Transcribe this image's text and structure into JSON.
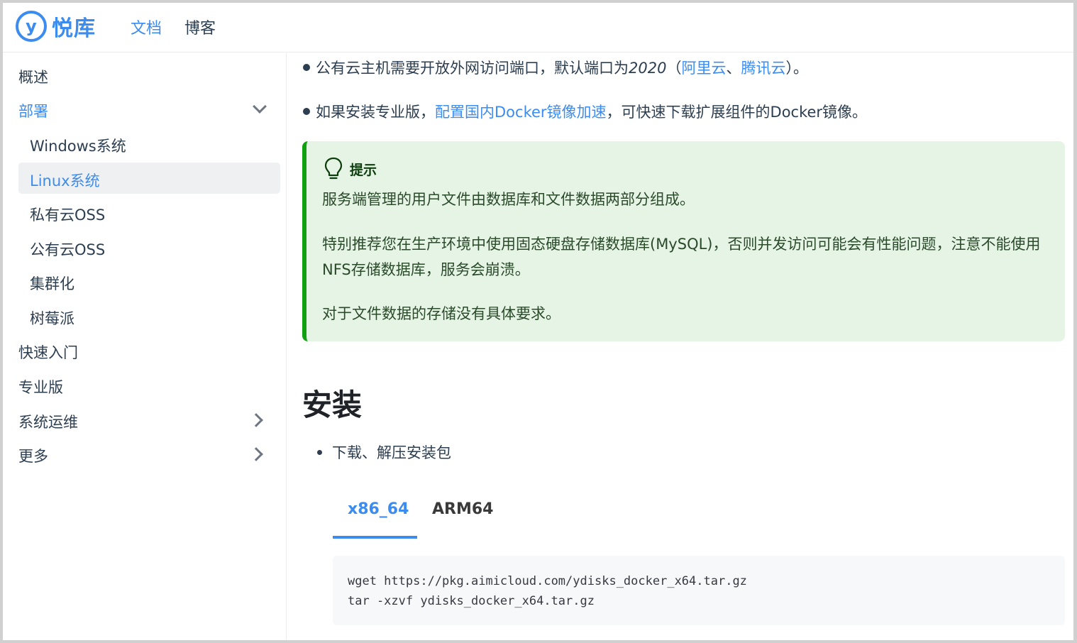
{
  "header": {
    "logo_glyph": "y",
    "logo_text": "悦库",
    "nav": [
      {
        "label": "文档",
        "active": true
      },
      {
        "label": "博客",
        "active": false
      }
    ]
  },
  "sidebar": {
    "items": [
      {
        "label": "概述"
      },
      {
        "label": "部署",
        "expanded": true
      },
      {
        "label": "快速入门"
      },
      {
        "label": "专业版"
      },
      {
        "label": "系统运维",
        "collapsed": true
      },
      {
        "label": "更多",
        "collapsed": true
      }
    ],
    "sub_items": [
      {
        "label": "Windows系统"
      },
      {
        "label": "Linux系统",
        "active": true
      },
      {
        "label": "私有云OSS"
      },
      {
        "label": "公有云OSS"
      },
      {
        "label": "集群化"
      },
      {
        "label": "树莓派"
      }
    ]
  },
  "content": {
    "line1": {
      "before": "公有云主机需要开放外网访问端口，默认端口为",
      "port": "2020",
      "paren_open": "（",
      "link1": "阿里云",
      "sep": "、",
      "link2": "腾讯云",
      "after": "）。"
    },
    "line2": {
      "before": "如果安装专业版，",
      "link": "配置国内Docker镜像加速",
      "after": "，可快速下载扩展组件的Docker镜像。"
    },
    "tip": {
      "title": "提示",
      "p1": "服务端管理的用户文件由数据库和文件数据两部分组成。",
      "p2": "特别推荐您在生产环境中使用固态硬盘存储数据库(MySQL)，否则并发访问可能会有性能问题，注意不能使用NFS存储数据库，服务会崩溃。",
      "p3": "对于文件数据的存储没有具体要求。"
    },
    "heading": "安装",
    "list_item": "下载、解压安装包",
    "tabs": [
      {
        "label": "x86_64",
        "active": true
      },
      {
        "label": "ARM64",
        "active": false
      }
    ],
    "code_lines": [
      "wget https://pkg.aimicloud.com/ydisks_docker_x64.tar.gz",
      "tar -xzvf ydisks_docker_x64.tar.gz"
    ]
  },
  "colors": {
    "accent": "#3c8cf0",
    "tip_bg": "#e6f4e6",
    "tip_border": "#10a010"
  }
}
